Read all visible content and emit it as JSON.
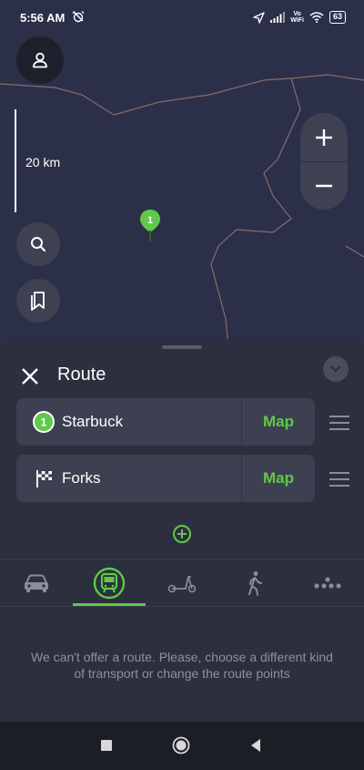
{
  "status_bar": {
    "time": "5:56 AM",
    "vowifi_top": "Vo",
    "vowifi_bottom": "WiFi",
    "battery": "63"
  },
  "map": {
    "scale_label": "20 km",
    "pin_label": "1"
  },
  "sheet": {
    "title": "Route",
    "points": [
      {
        "index": "1",
        "name": "Starbuck",
        "map_label": "Map"
      },
      {
        "name": "Forks",
        "map_label": "Map"
      }
    ],
    "selected_transport": "public-transport",
    "message": "We can't offer a route. Please, choose a different kind of transport or change the route points"
  },
  "colors": {
    "accent": "#5fc94a",
    "sheet_bg": "#2c2f3d",
    "map_bg": "#2b3048",
    "border_line": "#8a6b66"
  }
}
